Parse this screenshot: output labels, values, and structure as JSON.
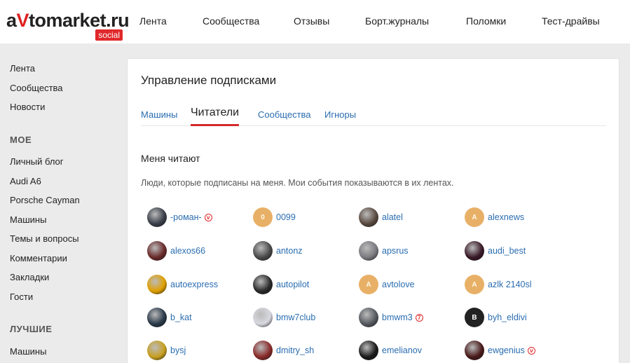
{
  "logo": {
    "text_a": "a",
    "text_v": "V",
    "text_rest": "tomarket.ru",
    "sub": "social"
  },
  "topnav": [
    "Лента",
    "Сообщества",
    "Отзывы",
    "Борт.журналы",
    "Поломки",
    "Тест-драйвы"
  ],
  "sidebar": {
    "main": [
      "Лента",
      "Сообщества",
      "Новости"
    ],
    "mine_header": "МОЕ",
    "mine": [
      "Личный блог",
      "Audi A6",
      "Porsche Cayman",
      "Машины",
      "Темы и вопросы",
      "Комментарии",
      "Закладки",
      "Гости"
    ],
    "best_header": "ЛУЧШИЕ",
    "best": [
      "Машины"
    ]
  },
  "page": {
    "title": "Управление подписками",
    "tabs": [
      "Машины",
      "Читатели",
      "Сообщества",
      "Игноры"
    ],
    "active_tab": "Читатели",
    "section_title": "Меня читают",
    "section_desc": "Люди, которые подписаны на меня. Мои события показываются в их лентах."
  },
  "users": [
    {
      "name": "-роман-",
      "avatar": "photo",
      "color": "#3a3f4a",
      "badge": "v"
    },
    {
      "name": "0099",
      "avatar": "0",
      "color": "#e8b066"
    },
    {
      "name": "alatel",
      "avatar": "photo",
      "color": "#5a4a40"
    },
    {
      "name": "alexnews",
      "avatar": "A",
      "color": "#e8b066"
    },
    {
      "name": "alexos66",
      "avatar": "photo",
      "color": "#6a2a2a"
    },
    {
      "name": "antonz",
      "avatar": "photo",
      "color": "#4a4a4a"
    },
    {
      "name": "apsrus",
      "avatar": "photo",
      "color": "#7a7a80"
    },
    {
      "name": "audi_best",
      "avatar": "photo",
      "color": "#3a1a28"
    },
    {
      "name": "autoexpress",
      "avatar": "photo",
      "color": "#e0a000"
    },
    {
      "name": "autopilot",
      "avatar": "photo",
      "color": "#2a2a2a"
    },
    {
      "name": "avtolove",
      "avatar": "A",
      "color": "#e8b066"
    },
    {
      "name": "azlk 2140sl",
      "avatar": "A",
      "color": "#e8b066"
    },
    {
      "name": "b_kat",
      "avatar": "photo",
      "color": "#2a3a4a"
    },
    {
      "name": "bmw7club",
      "avatar": "photo",
      "color": "#d8d8e0"
    },
    {
      "name": "bmwm3",
      "avatar": "photo",
      "color": "#555a60",
      "badge": "7"
    },
    {
      "name": "byh_eldivi",
      "avatar": "B",
      "color": "#222222"
    },
    {
      "name": "bysj",
      "avatar": "photo",
      "color": "#c8a020"
    },
    {
      "name": "dmitry_sh",
      "avatar": "photo",
      "color": "#8a2a2a"
    },
    {
      "name": "emelianov",
      "avatar": "photo",
      "color": "#1a1a1a"
    },
    {
      "name": "ewgenius",
      "avatar": "photo",
      "color": "#4a1a1a",
      "badge": "v"
    }
  ]
}
